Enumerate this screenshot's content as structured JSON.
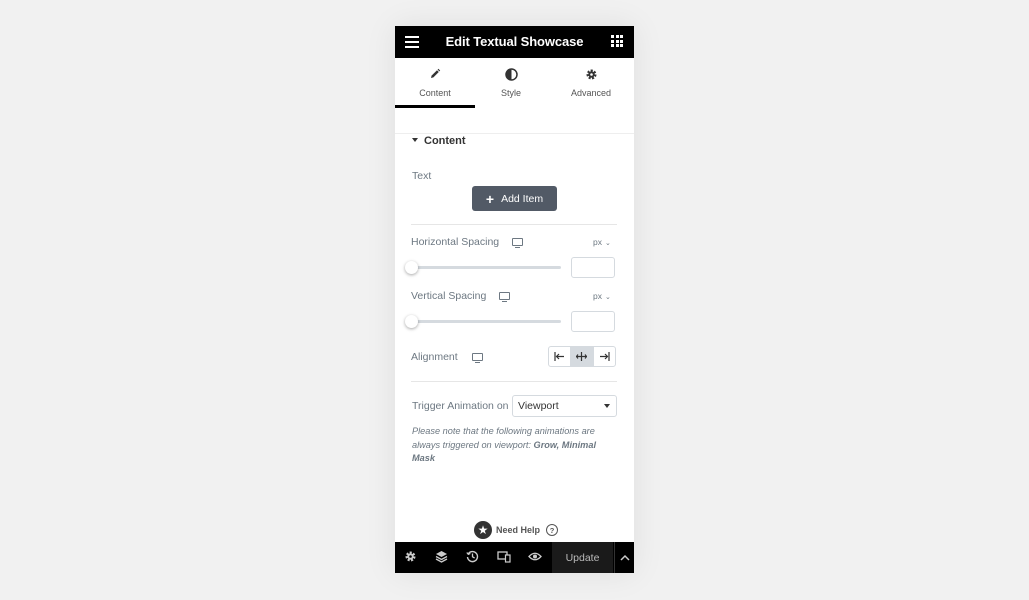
{
  "header": {
    "title": "Edit Textual Showcase",
    "menu_icon": "hamburger-icon",
    "apps_icon": "grid-icon"
  },
  "tabs": [
    {
      "label": "Content",
      "icon": "pencil-icon",
      "active": true
    },
    {
      "label": "Style",
      "icon": "half-circle-icon",
      "active": false
    },
    {
      "label": "Advanced",
      "icon": "gear-icon",
      "active": false
    }
  ],
  "section": {
    "title": "Content"
  },
  "text_field": {
    "label": "Text",
    "add_button": "Add Item"
  },
  "horizontal_spacing": {
    "label": "Horizontal Spacing",
    "unit": "px",
    "value": "",
    "slider_position": 0
  },
  "vertical_spacing": {
    "label": "Vertical Spacing",
    "unit": "px",
    "value": "",
    "slider_position": 0
  },
  "alignment": {
    "label": "Alignment",
    "options": [
      "align-left",
      "align-center",
      "align-right"
    ],
    "selected": "align-center"
  },
  "trigger": {
    "label": "Trigger Animation on",
    "value": "Viewport"
  },
  "note": {
    "text": "Please note that the following animations are always triggered on viewport: ",
    "emphasis": "Grow, Minimal Mask"
  },
  "help": {
    "label": "Need Help"
  },
  "footer": {
    "update_label": "Update"
  },
  "colors": {
    "header_bg": "#000000",
    "button_bg": "#525a66",
    "accent_active": "#000000"
  }
}
